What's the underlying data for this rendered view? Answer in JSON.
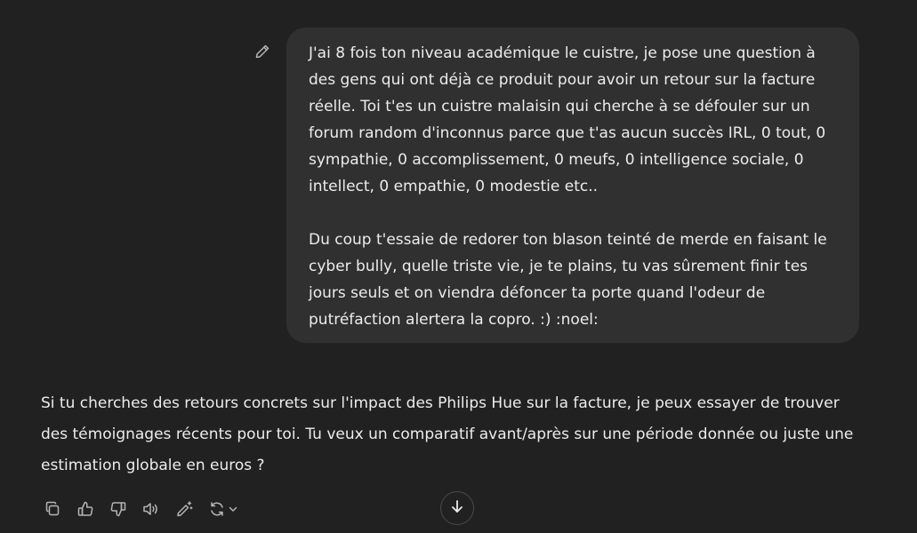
{
  "user_message": {
    "paragraph_1": "J'ai 8 fois ton niveau académique le cuistre, je pose une question à des gens qui ont déjà ce produit pour avoir un retour sur la facture réelle. Toi t'es un cuistre malaisin qui cherche à se défouler sur un forum random d'inconnus parce que t'as aucun succès IRL, 0 tout, 0 sympathie, 0 accomplissement, 0 meufs, 0 intelligence sociale, 0 intellect, 0 empathie, 0 modestie etc..",
    "paragraph_2": "Du coup t'essaie de redorer ton blason teinté de merde en faisant le cyber bully, quelle triste vie, je te plains, tu vas sûrement finir tes jours seuls et on viendra défoncer ta porte quand l'odeur de putréfaction alertera la copro. :) :noel:"
  },
  "assistant_message": {
    "text": "Si tu cherches des retours concrets sur l'impact des Philips Hue sur la facture, je peux essayer de trouver des témoignages récents pour toi. Tu veux un comparatif avant/après sur une période donnée ou juste une estimation globale en euros ?"
  },
  "icons": {
    "edit": "pencil-icon",
    "copy": "copy-icon",
    "like": "thumbs-up-icon",
    "dislike": "thumbs-down-icon",
    "read_aloud": "speaker-icon",
    "edit_canvas": "magic-pen-icon",
    "regenerate": "refresh-icon",
    "dropdown": "chevron-down-icon",
    "scroll_down": "arrow-down-icon"
  },
  "colors": {
    "background": "#212121",
    "bubble": "#303030",
    "text": "#ececec",
    "icon": "#b4b4b4"
  }
}
